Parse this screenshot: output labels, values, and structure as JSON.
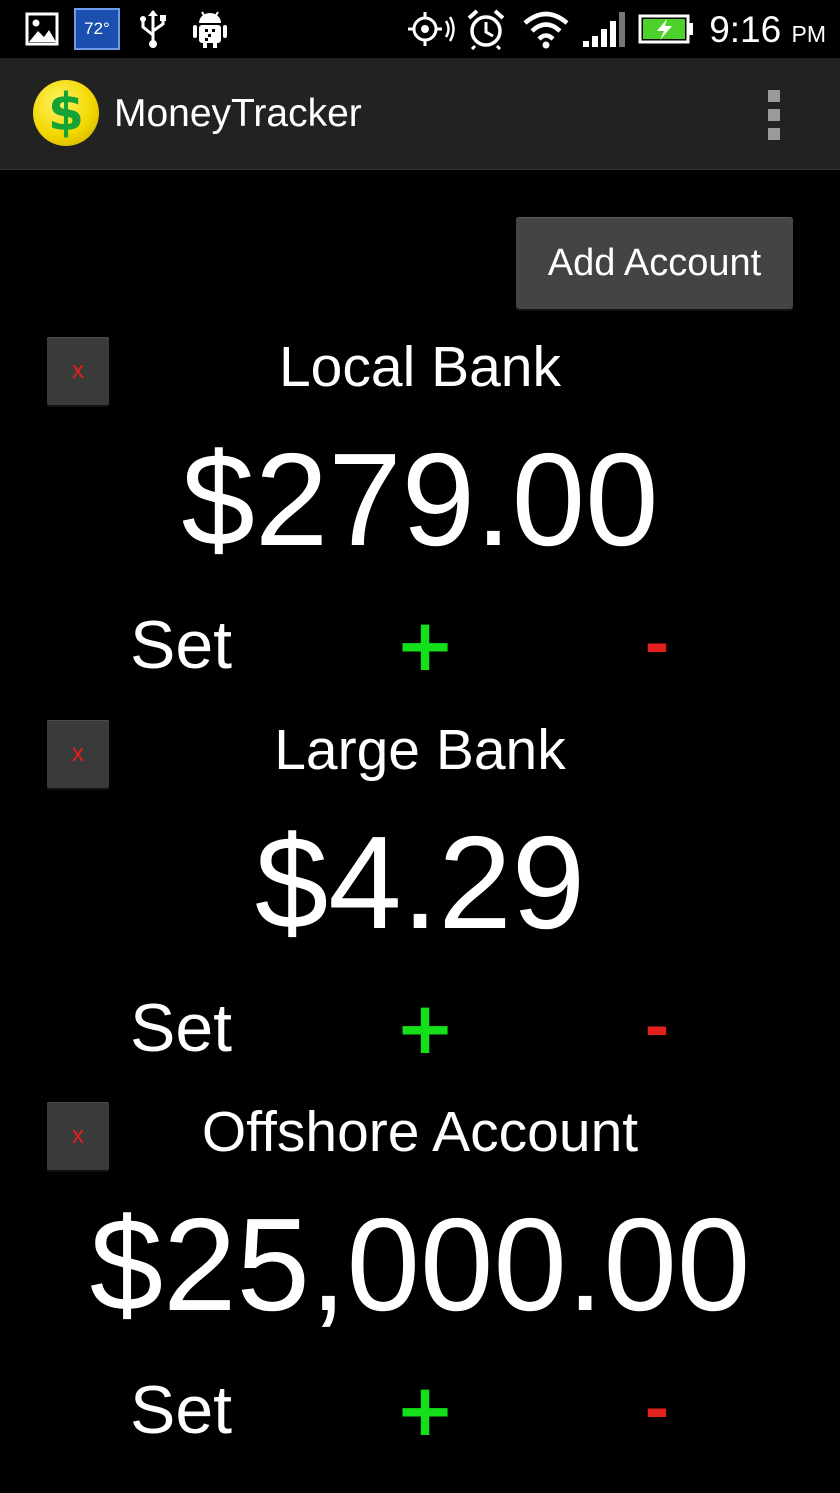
{
  "status_bar": {
    "icons": [
      "gallery-icon",
      "weather-icon",
      "usb-icon",
      "android-debug-icon",
      "gps-icon",
      "alarm-icon",
      "wifi-icon",
      "signal-icon",
      "battery-charging-icon"
    ],
    "temperature": "72°",
    "time": "9:16",
    "ampm": "PM"
  },
  "action_bar": {
    "logo_symbol": "$",
    "title": "MoneyTracker"
  },
  "add_account_label": "Add Account",
  "accounts": [
    {
      "delete_label": "x",
      "name": "Local Bank",
      "balance": "$279.00",
      "set_label": "Set",
      "plus_label": "+",
      "minus_label": "-"
    },
    {
      "delete_label": "x",
      "name": "Large Bank",
      "balance": "$4.29",
      "set_label": "Set",
      "plus_label": "+",
      "minus_label": "-"
    },
    {
      "delete_label": "x",
      "name": "Offshore Account",
      "balance": "$25,000.00",
      "set_label": "Set",
      "plus_label": "+",
      "minus_label": "-"
    }
  ],
  "colors": {
    "background": "#000000",
    "action_bar": "#222222",
    "plus": "#14e01a",
    "minus": "#e2201c",
    "button": "#444444"
  }
}
